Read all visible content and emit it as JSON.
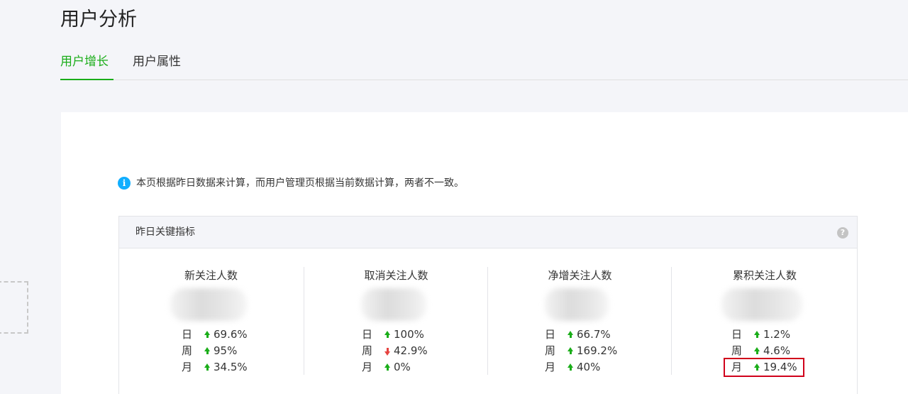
{
  "page_title": "用户分析",
  "tabs": [
    {
      "label": "用户增长",
      "active": true
    },
    {
      "label": "用户属性",
      "active": false
    }
  ],
  "notice": {
    "icon": "info-icon",
    "text": "本页根据昨日数据来计算，而用户管理页根据当前数据计算，两者不一致。"
  },
  "panel": {
    "title": "昨日关键指标",
    "help_icon": "question-icon",
    "help_symbol": "?"
  },
  "metrics": [
    {
      "label": "新关注人数",
      "value_hidden": true,
      "trends": [
        {
          "period": "日",
          "direction": "up",
          "value": "69.6%"
        },
        {
          "period": "周",
          "direction": "up",
          "value": "95%"
        },
        {
          "period": "月",
          "direction": "up",
          "value": "34.5%"
        }
      ]
    },
    {
      "label": "取消关注人数",
      "value_hidden": true,
      "trends": [
        {
          "period": "日",
          "direction": "up",
          "value": "100%"
        },
        {
          "period": "周",
          "direction": "down",
          "value": "42.9%"
        },
        {
          "period": "月",
          "direction": "up",
          "value": "0%"
        }
      ]
    },
    {
      "label": "净增关注人数",
      "value_hidden": true,
      "trends": [
        {
          "period": "日",
          "direction": "up",
          "value": "66.7%"
        },
        {
          "period": "周",
          "direction": "up",
          "value": "169.2%"
        },
        {
          "period": "月",
          "direction": "up",
          "value": "40%"
        }
      ]
    },
    {
      "label": "累积关注人数",
      "value_hidden": true,
      "trends": [
        {
          "period": "日",
          "direction": "up",
          "value": "1.2%"
        },
        {
          "period": "周",
          "direction": "up",
          "value": "4.6%"
        },
        {
          "period": "月",
          "direction": "up",
          "value": "19.4%",
          "highlighted": true
        }
      ]
    }
  ],
  "colors": {
    "accent": "#1aad19",
    "down": "#e64340",
    "info": "#10aeff",
    "highlight": "#d0021b"
  }
}
